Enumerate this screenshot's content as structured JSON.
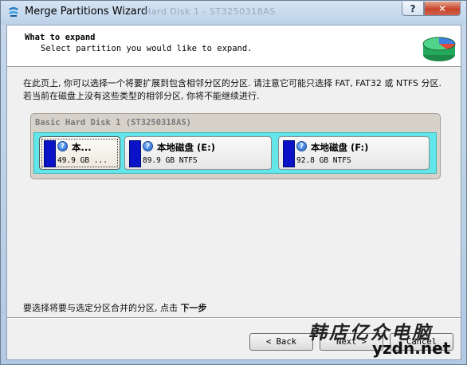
{
  "window": {
    "title": "Merge Partitions Wizard",
    "title_background_text": "Hard Disk 1 - ST3250318AS",
    "help_label": "?",
    "close_label": "✕"
  },
  "header": {
    "title": "What to expand",
    "subtitle": "Select partition you would like to expand."
  },
  "description": "在此页上, 你可以选择一个将要扩展到包含相邻分区的分区. 请注意它可能只选择 FAT, FAT32 或 NTFS 分区. 若当前在磁盘上没有这些类型的相邻分区, 你将不能继续进行.",
  "disk": {
    "label": "Basic Hard Disk 1 (ST3250318AS)",
    "partitions": [
      {
        "name": "本...",
        "info": "49.9 GB ...",
        "selected": true
      },
      {
        "name": "本地磁盘 (E:)",
        "info": "89.9 GB NTFS",
        "selected": false
      },
      {
        "name": "本地磁盘 (F:)",
        "info": "92.8 GB NTFS",
        "selected": false
      }
    ]
  },
  "hint": {
    "text": "要选择将要与选定分区合并的分区, 点击 ",
    "emphasis": "下一步"
  },
  "buttons": {
    "back": "< Back",
    "next": "Next >",
    "cancel": "Cancel"
  },
  "watermark": {
    "brand": "韩店亿众电脑",
    "url": "yzdn.net"
  },
  "colors": {
    "partition_bar": "#0a12c8",
    "disk_track": "#62e6ea",
    "title_bar": "#bcd1e9"
  }
}
